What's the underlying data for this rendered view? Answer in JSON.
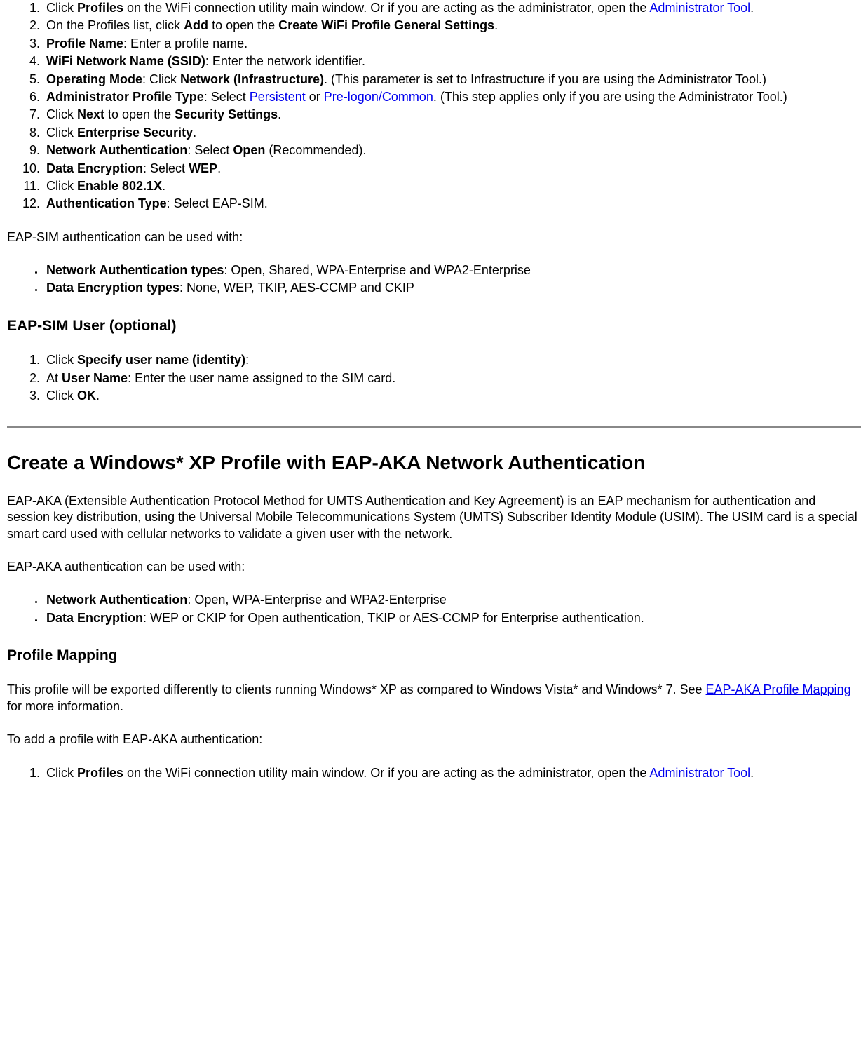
{
  "ol1": {
    "i1": {
      "a": "Click ",
      "b": "Profiles",
      "c": " on the WiFi connection utility main window. Or if you are acting as the administrator, open the ",
      "link": "Administrator Tool",
      "d": "."
    },
    "i2": {
      "a": "On the Profiles list, click ",
      "b": "Add",
      "c": " to open the ",
      "d": "Create WiFi Profile General Settings",
      "e": "."
    },
    "i3": {
      "a": "Profile Name",
      "b": ": Enter a profile name."
    },
    "i4": {
      "a": "WiFi Network Name (SSID)",
      "b": ": Enter the network identifier."
    },
    "i5": {
      "a": "Operating Mode",
      "b": ": Click ",
      "c": "Network (Infrastructure)",
      "d": ". (This parameter is set to Infrastructure if you are using the Administrator Tool.)"
    },
    "i6": {
      "a": "Administrator Profile Type",
      "b": ": Select ",
      "link1": "Persistent",
      "c": " or ",
      "link2": "Pre-logon/Common",
      "d": ". (This step applies only if you are using the Administrator Tool.)"
    },
    "i7": {
      "a": "Click ",
      "b": "Next",
      "c": " to open the ",
      "d": "Security Settings",
      "e": "."
    },
    "i8": {
      "a": "Click ",
      "b": "Enterprise Security",
      "c": "."
    },
    "i9": {
      "a": "Network Authentication",
      "b": ": Select ",
      "c": "Open",
      "d": " (Recommended)."
    },
    "i10": {
      "a": "Data Encryption",
      "b": ": Select ",
      "c": "WEP",
      "d": "."
    },
    "i11": {
      "a": "Click ",
      "b": "Enable 802.1X",
      "c": "."
    },
    "i12": {
      "a": "Authentication Type",
      "b": ": Select EAP-SIM."
    }
  },
  "p1": "EAP-SIM authentication can be used with:",
  "ul1": {
    "i1": {
      "a": "Network Authentication types",
      "b": ": Open, Shared, WPA-Enterprise and WPA2-Enterprise"
    },
    "i2": {
      "a": "Data Encryption types",
      "b": ": None, WEP, TKIP, AES-CCMP and CKIP"
    }
  },
  "h3a": "EAP-SIM User (optional)",
  "ol2": {
    "i1": {
      "a": "Click ",
      "b": "Specify user name (identity)",
      "c": ":"
    },
    "i2": {
      "a": "At ",
      "b": "User Name",
      "c": ": Enter the user name assigned to the SIM card."
    },
    "i3": {
      "a": "Click ",
      "b": "OK",
      "c": "."
    }
  },
  "h2": "Create a Windows* XP Profile with EAP-AKA Network Authentication",
  "p2": "EAP-AKA (Extensible Authentication Protocol Method for UMTS Authentication and Key Agreement) is an EAP mechanism for authentication and session key distribution, using the Universal Mobile Telecommunications System (UMTS) Subscriber Identity Module (USIM). The USIM card is a special smart card used with cellular networks to validate a given user with the network.",
  "p3": "EAP-AKA authentication can be used with:",
  "ul2": {
    "i1": {
      "a": "Network Authentication",
      "b": ": Open, WPA-Enterprise and WPA2-Enterprise"
    },
    "i2": {
      "a": "Data Encryption",
      "b": ": WEP or CKIP for Open authentication, TKIP or AES-CCMP for Enterprise authentication."
    }
  },
  "h3b": "Profile Mapping",
  "p4": {
    "a": "This profile will be exported differently to clients running Windows* XP as compared to Windows Vista* and Windows* 7. See ",
    "link": "EAP-AKA Profile Mapping",
    "b": " for more information."
  },
  "p5": "To add a profile with EAP-AKA authentication:",
  "ol3": {
    "i1": {
      "a": "Click ",
      "b": "Profiles",
      "c": " on the WiFi connection utility main window. Or if you are acting as the administrator, open the ",
      "link": "Administrator Tool",
      "d": "."
    }
  }
}
